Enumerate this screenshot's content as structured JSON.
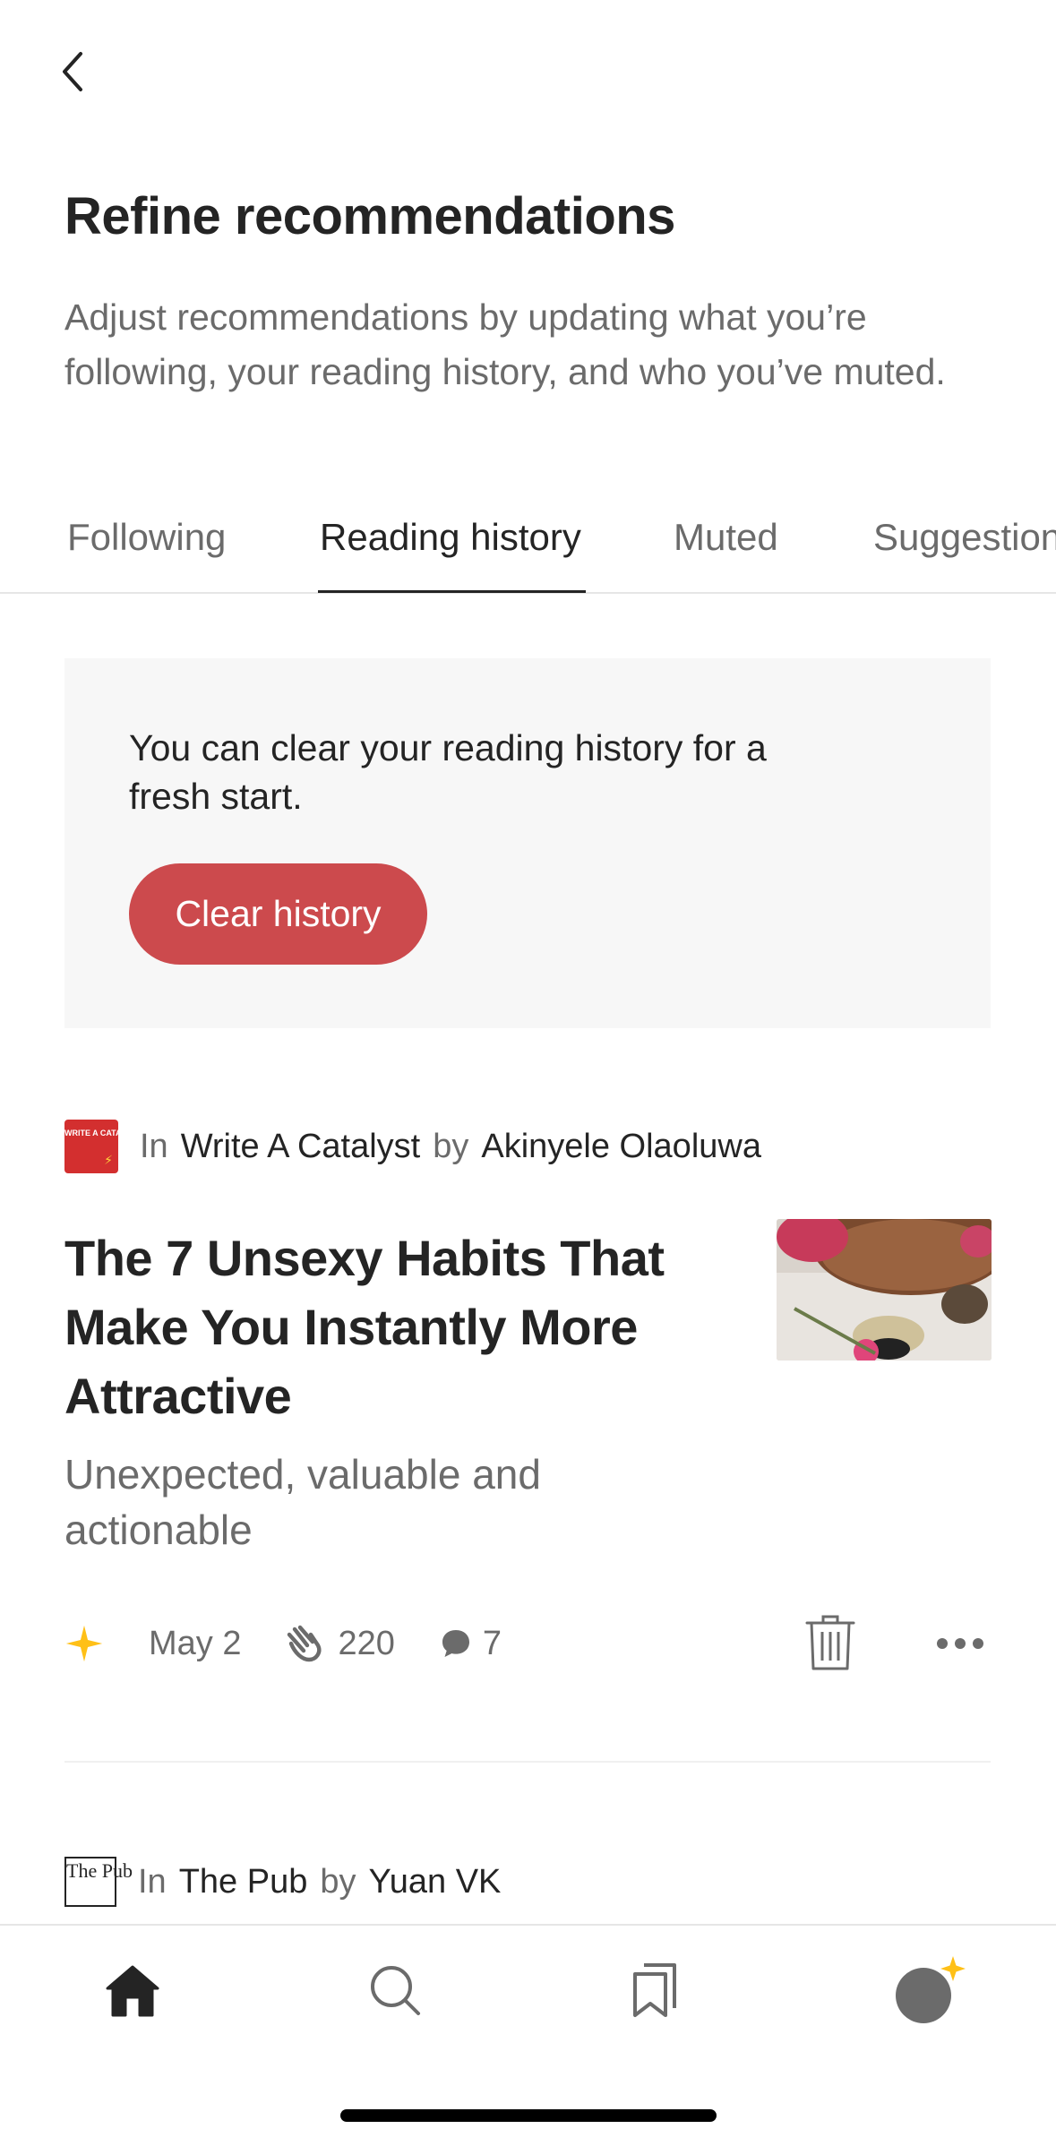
{
  "header": {
    "title": "Refine recommendations",
    "subtitle": "Adjust recommendations by updating what you’re following, your reading history, and who you’ve muted."
  },
  "tabs": [
    {
      "label": "Following",
      "active": false
    },
    {
      "label": "Reading history",
      "active": true
    },
    {
      "label": "Muted",
      "active": false
    },
    {
      "label": "Suggestions",
      "active": false
    }
  ],
  "info_card": {
    "text": "You can clear your reading history for a fresh start.",
    "button_label": "Clear history",
    "button_color": "#cc4a4d"
  },
  "articles": [
    {
      "in_label": "In",
      "publication": "Write A Catalyst",
      "by_label": "by",
      "author": "Akinyele Olaoluwa",
      "logo_text": "WRITE A CATALYST",
      "title": "The 7 Unsexy Habits That Make You Instantly More Attractive",
      "subtitle": "Unexpected, valuable and actionable",
      "date": "May 2",
      "claps": "220",
      "comments": "7",
      "member_only_icon": "star-icon",
      "thumbnail": "article-thumbnail"
    },
    {
      "in_label": "In",
      "publication": "The Pub",
      "by_label": "by",
      "author": "Yuan VK",
      "logo_text": "The Pub"
    }
  ],
  "bottom_nav": [
    {
      "icon": "home-icon",
      "active": true
    },
    {
      "icon": "search-icon",
      "active": false
    },
    {
      "icon": "bookmarks-icon",
      "active": false
    },
    {
      "icon": "profile-avatar-icon",
      "active": false
    }
  ],
  "colors": {
    "accent_star": "#ffc017",
    "text_primary": "#242424",
    "text_secondary": "#6b6b6b"
  }
}
